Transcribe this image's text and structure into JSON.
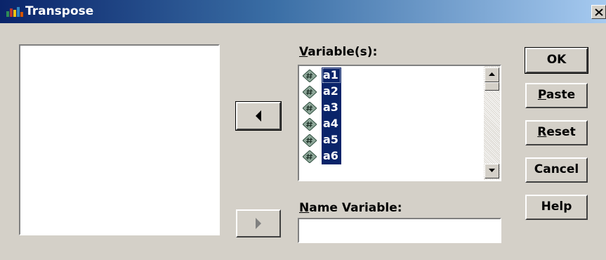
{
  "window": {
    "title": "Transpose",
    "close_glyph": "×"
  },
  "icons": {
    "app": "spss-app-icon",
    "close": "close-icon",
    "variable": "scale-variable-icon",
    "move_left": "arrow-left-icon",
    "move_right": "arrow-right-icon",
    "scroll_up": "scroll-up-icon",
    "scroll_down": "scroll-down-icon"
  },
  "source_list": {
    "items": []
  },
  "variables": {
    "label_access": "V",
    "label_rest": "ariable(s):",
    "items": [
      "a1",
      "a2",
      "a3",
      "a4",
      "a5",
      "a6"
    ],
    "focused_index": 0
  },
  "name_variable": {
    "label_access": "N",
    "label_rest": "ame Variable:",
    "value": ""
  },
  "buttons": {
    "ok": "OK",
    "paste_access": "P",
    "paste_rest": "aste",
    "reset_access": "R",
    "reset_rest": "eset",
    "cancel": "Cancel",
    "help": "Help"
  },
  "colors": {
    "face": "#d4d0c8",
    "selection": "#0a246a",
    "title_start": "#0a246a",
    "title_end": "#a6caf0"
  }
}
